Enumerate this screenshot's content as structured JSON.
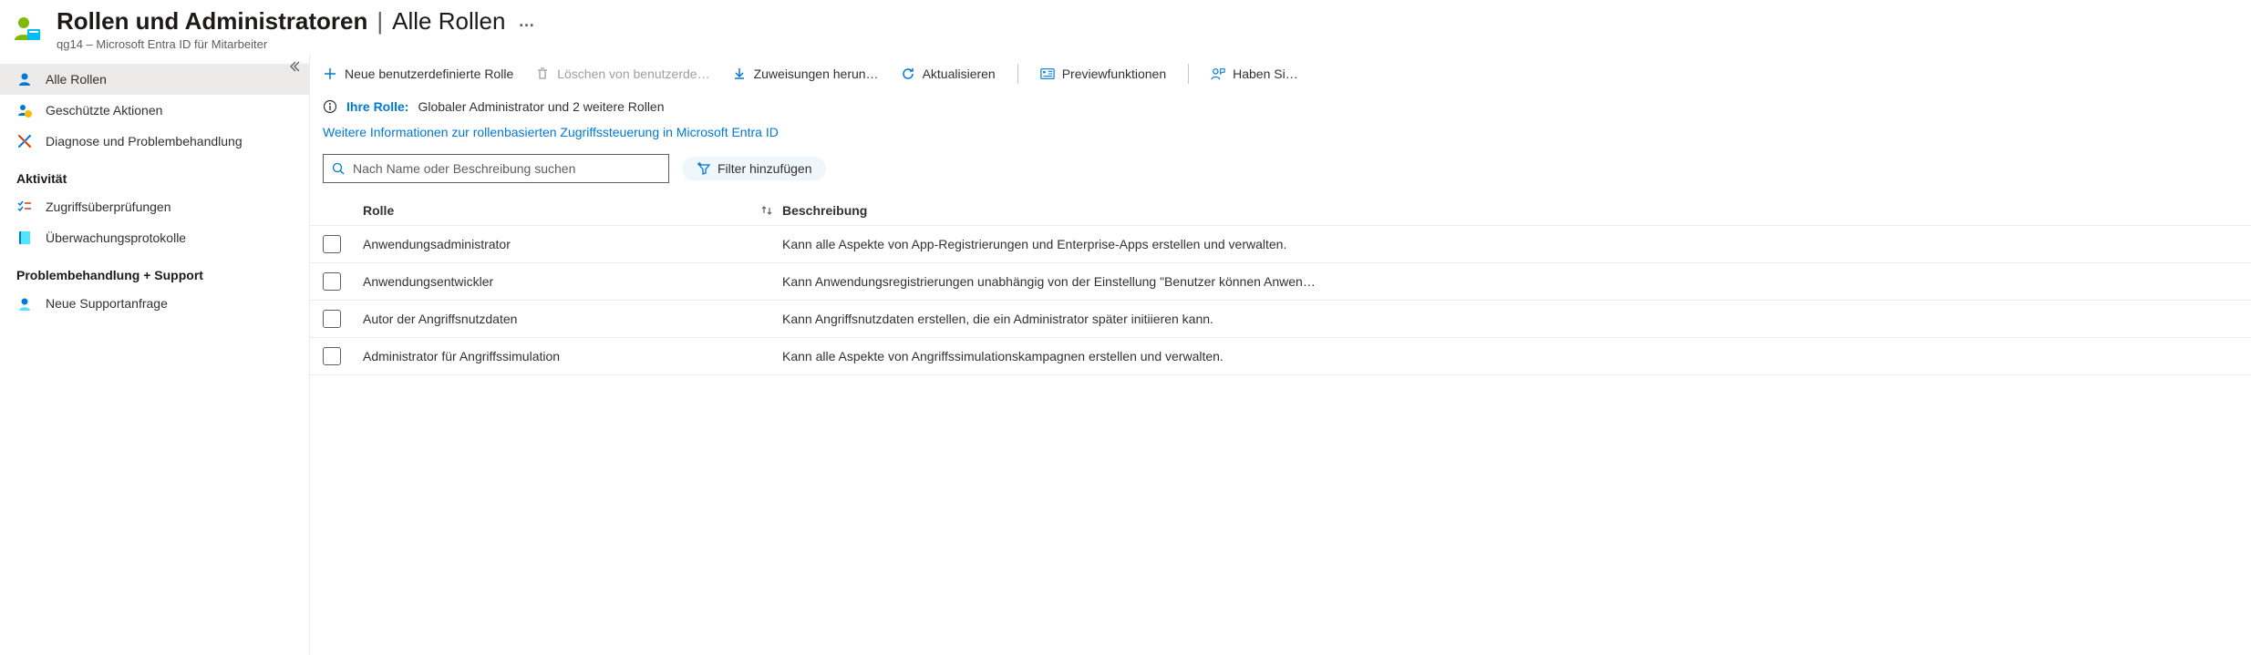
{
  "header": {
    "title_main": "Rollen und Administratoren",
    "title_sep": "|",
    "title_sub": "Alle Rollen",
    "more": "…",
    "subtitle": "qg14 – Microsoft Entra ID für Mitarbeiter"
  },
  "sidebar": {
    "items": [
      {
        "label": "Alle Rollen",
        "icon": "person-icon"
      },
      {
        "label": "Geschützte Aktionen",
        "icon": "shield-person-icon"
      },
      {
        "label": "Diagnose und Problembehandlung",
        "icon": "tools-icon"
      }
    ],
    "section_activity": "Aktivität",
    "activity_items": [
      {
        "label": "Zugriffsüberprüfungen",
        "icon": "checklist-icon"
      },
      {
        "label": "Überwachungsprotokolle",
        "icon": "book-icon"
      }
    ],
    "section_support": "Problembehandlung + Support",
    "support_items": [
      {
        "label": "Neue Supportanfrage",
        "icon": "support-icon"
      }
    ]
  },
  "toolbar": {
    "new_role": "Neue benutzerdefinierte Rolle",
    "delete": "Löschen von benutzerde…",
    "download": "Zuweisungen herun…",
    "refresh": "Aktualisieren",
    "preview": "Previewfunktionen",
    "feedback": "Haben Si…"
  },
  "info": {
    "label": "Ihre Rolle:",
    "text": "Globaler Administrator und 2 weitere Rollen"
  },
  "link": {
    "text": "Weitere Informationen zur rollenbasierten Zugriffssteuerung in Microsoft Entra ID"
  },
  "search": {
    "placeholder": "Nach Name oder Beschreibung suchen"
  },
  "filter": {
    "label": "Filter hinzufügen"
  },
  "table": {
    "col_role": "Rolle",
    "col_desc": "Beschreibung",
    "rows": [
      {
        "role": "Anwendungsadministrator",
        "desc": "Kann alle Aspekte von App-Registrierungen und Enterprise-Apps erstellen und verwalten."
      },
      {
        "role": "Anwendungsentwickler",
        "desc": "Kann Anwendungsregistrierungen unabhängig von der Einstellung \"Benutzer können Anwen…"
      },
      {
        "role": "Autor der Angriffsnutzdaten",
        "desc": "Kann Angriffsnutzdaten erstellen, die ein Administrator später initiieren kann."
      },
      {
        "role": "Administrator für Angriffssimulation",
        "desc": "Kann alle Aspekte von Angriffssimulationskampagnen erstellen und verwalten."
      }
    ]
  }
}
